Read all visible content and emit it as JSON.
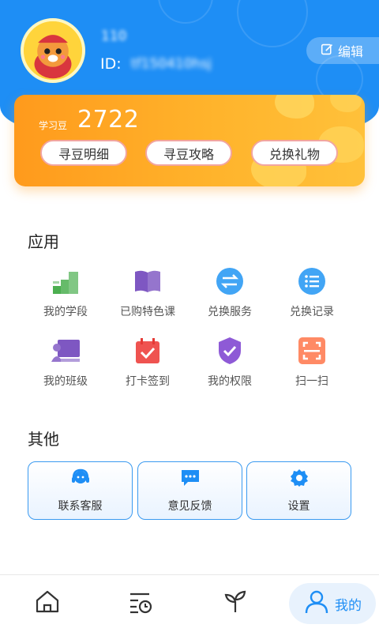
{
  "profile": {
    "name": "110",
    "id_label": "ID:",
    "id_value": "tf150410hsj",
    "edit_label": "编辑"
  },
  "beans": {
    "label": "学习豆",
    "count": "2722",
    "buttons": [
      "寻豆明细",
      "寻豆攻略",
      "兑换礼物"
    ]
  },
  "apps": {
    "title": "应用",
    "items": [
      {
        "label": "我的学段",
        "icon": "stairs-icon"
      },
      {
        "label": "已购特色课",
        "icon": "book-icon"
      },
      {
        "label": "兑换服务",
        "icon": "exchange-icon"
      },
      {
        "label": "兑换记录",
        "icon": "list-icon"
      },
      {
        "label": "我的班级",
        "icon": "classroom-icon"
      },
      {
        "label": "打卡签到",
        "icon": "calendar-check-icon"
      },
      {
        "label": "我的权限",
        "icon": "shield-check-icon"
      },
      {
        "label": "扫一扫",
        "icon": "scan-icon"
      }
    ]
  },
  "other": {
    "title": "其他",
    "items": [
      {
        "label": "联系客服",
        "icon": "headset-icon"
      },
      {
        "label": "意见反馈",
        "icon": "feedback-icon"
      },
      {
        "label": "设置",
        "icon": "gear-icon"
      }
    ]
  },
  "nav": {
    "items": [
      {
        "name": "home",
        "icon": "home-icon"
      },
      {
        "name": "history",
        "icon": "history-icon"
      },
      {
        "name": "growth",
        "icon": "sprout-icon"
      },
      {
        "name": "mine",
        "icon": "user-icon"
      }
    ],
    "active_label": "我的"
  },
  "colors": {
    "primary": "#1e8ef5",
    "card_orange": "#ffa726",
    "accent_green": "#4caf50",
    "accent_purple": "#7e57c2",
    "accent_red": "#ef5350",
    "accent_orange": "#ff7043"
  }
}
